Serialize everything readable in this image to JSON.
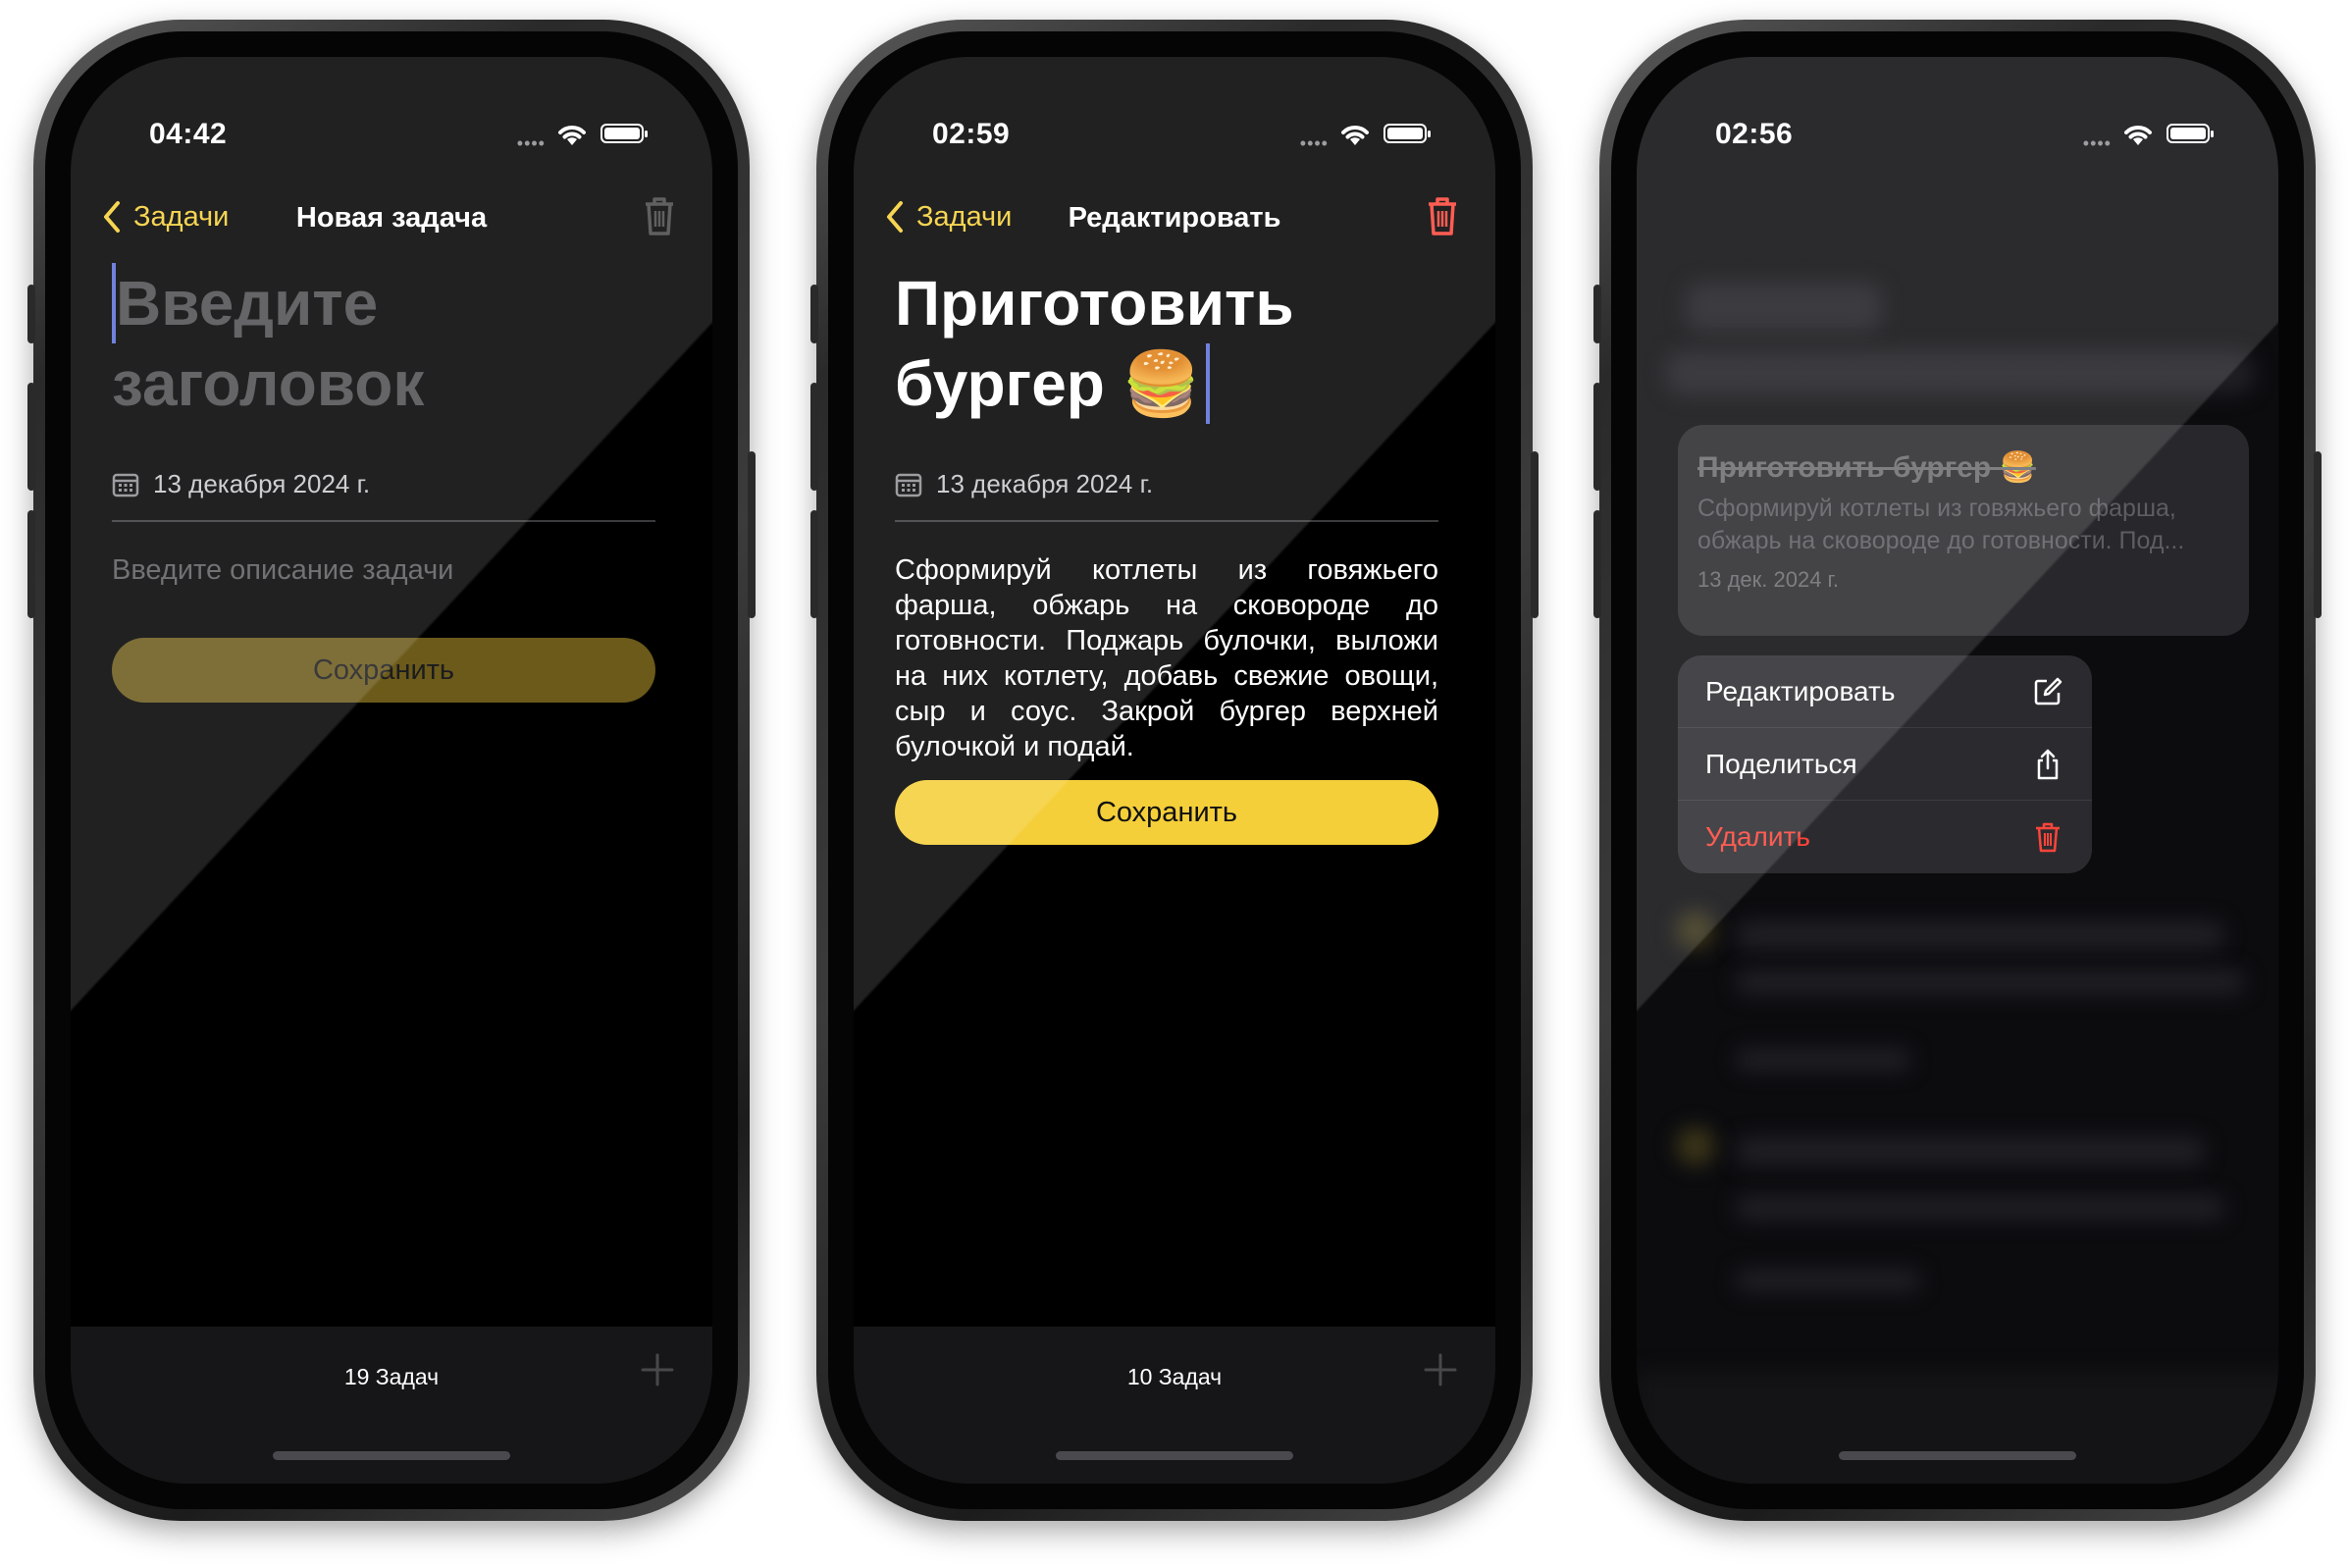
{
  "phones": [
    {
      "status": {
        "time": "04:42"
      },
      "nav": {
        "back_label": "Задачи",
        "title": "Новая задача"
      },
      "title_placeholder_line1": "Введите",
      "title_placeholder_line2": "заголовок",
      "date": "13 декабря 2024 г.",
      "description_placeholder": "Введите описание задачи",
      "save_label": "Сохранить",
      "footer": {
        "count": "19 Задач"
      }
    },
    {
      "status": {
        "time": "02:59"
      },
      "nav": {
        "back_label": "Задачи",
        "title": "Редактировать"
      },
      "title_line1": "Приготовить",
      "title_line2": "бургер 🍔",
      "date": "13 декабря 2024 г.",
      "description": "Сформируй котлеты из говяжьего фарша, обжарь на сковороде до готовности. Поджарь булочки, выложи на них котлету, добавь свежие овощи, сыр и соус. Закрой бургер верхней булочкой и подай.",
      "save_label": "Сохранить",
      "footer": {
        "count": "10 Задач"
      }
    },
    {
      "status": {
        "time": "02:56"
      },
      "card": {
        "title": "Приготовить бургер 🍔",
        "description": "Сформируй котлеты из говяжьего фарша, обжарь на сковороде до готовности. Под...",
        "date": "13 дек. 2024 г."
      },
      "menu": [
        {
          "label": "Редактировать",
          "icon": "edit-icon"
        },
        {
          "label": "Поделиться",
          "icon": "share-icon"
        },
        {
          "label": "Удалить",
          "icon": "trash-icon"
        }
      ]
    }
  ],
  "colors": {
    "accent": "#f5cf3a",
    "destructive": "#ff453a",
    "background": "#000000"
  }
}
